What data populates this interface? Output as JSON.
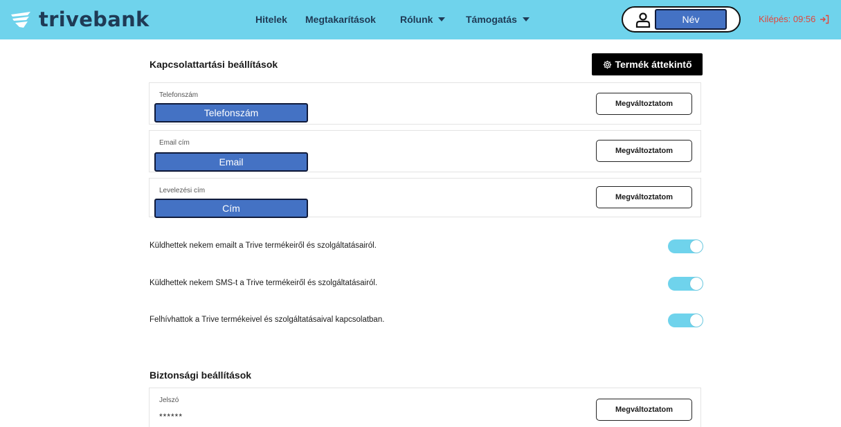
{
  "header": {
    "logo_text": "trivebank",
    "nav": {
      "loans": "Hitelek",
      "savings": "Megtakarítások",
      "about": "Rólunk",
      "support": "Támogatás"
    },
    "user_name": "Név",
    "logout": "Kilépés: 09:56"
  },
  "contact": {
    "title": "Kapcsolattartási beállítások",
    "product_button": "Termék áttekintő",
    "phone": {
      "label": "Telefonszám",
      "value": "Telefonszám",
      "button": "Megváltoztatom"
    },
    "email": {
      "label": "Email cím",
      "value": "Email",
      "button": "Megváltoztatom"
    },
    "address": {
      "label": "Levelezési cím",
      "value": "Cím",
      "button": "Megváltoztatom"
    }
  },
  "preferences": [
    {
      "label": "Küldhettek nekem emailt a Trive termékeiről és szolgáltatásairól.",
      "enabled": true
    },
    {
      "label": "Küldhettek nekem SMS-t a Trive termékeiről és szolgáltatásairól.",
      "enabled": true
    },
    {
      "label": "Felhívhattok a Trive termékeivel és szolgáltatásaival kapcsolatban.",
      "enabled": true
    }
  ],
  "security": {
    "title": "Biztonsági beállítások",
    "password": {
      "label": "Jelszó",
      "value": "******",
      "button": "Megváltoztatom"
    }
  },
  "colors": {
    "header_bg": "#6fd3ec",
    "brand_dark": "#1f3a55",
    "field_blue": "#4472c4",
    "logout_red": "#e2463b",
    "toggle_on": "#6fd3ec"
  },
  "icons": [
    "trive-logo-icon",
    "user-icon",
    "logout-icon",
    "gear-icon"
  ]
}
